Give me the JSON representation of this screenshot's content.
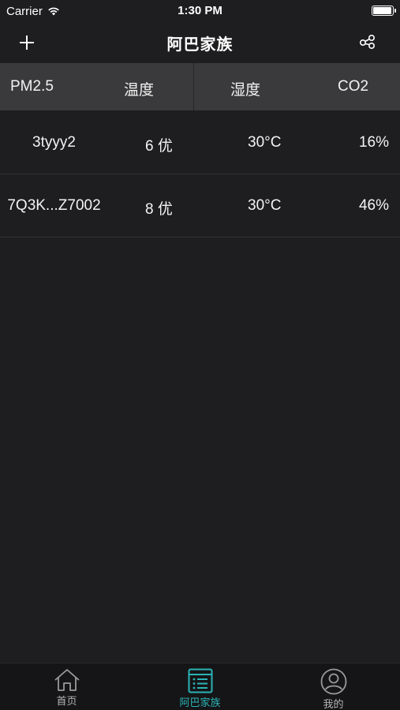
{
  "status_bar": {
    "carrier": "Carrier",
    "time": "1:30 PM",
    "battery_level": 0.95
  },
  "nav": {
    "title": "阿巴家族",
    "left_icon": "plus-icon",
    "right_icon": "share-icon"
  },
  "table": {
    "headers": [
      "PM2.5",
      "温度",
      "湿度",
      "CO2"
    ],
    "rows": [
      {
        "name": "3tyyy2",
        "pm": "6 优",
        "temp": "30°C",
        "humidity": "16%"
      },
      {
        "name": "7Q3K...Z7002",
        "pm": "8 优",
        "temp": "30°C",
        "humidity": "46%"
      }
    ]
  },
  "tabbar": {
    "accent_color": "#2bb3b5",
    "items": [
      {
        "label": "首页",
        "icon": "home-icon"
      },
      {
        "label": "阿巴家族",
        "icon": "list-icon",
        "active": true
      },
      {
        "label": "我的",
        "icon": "user-icon"
      }
    ]
  }
}
